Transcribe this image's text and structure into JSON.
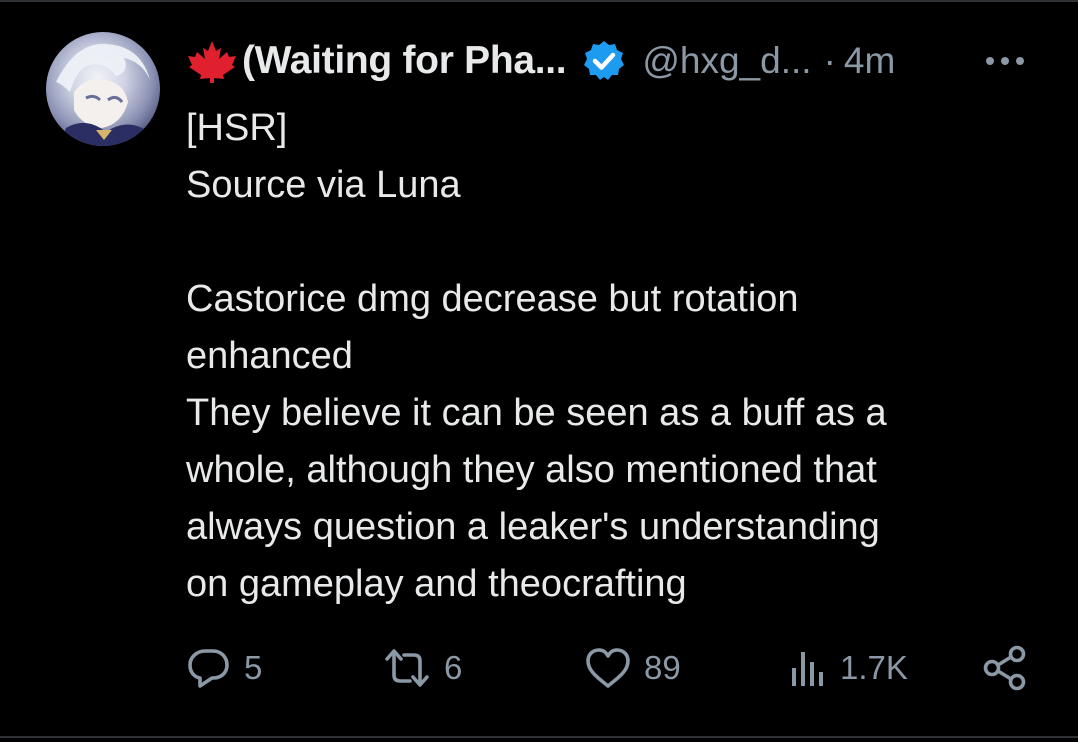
{
  "tweet": {
    "author": {
      "flag_icon": "maple-leaf-icon",
      "display_name": "(Waiting for Pha...",
      "verified_icon": "verified-badge-icon",
      "handle": "@hxg_d...",
      "separator": "·",
      "time": "4m"
    },
    "more_icon": "more-dots-icon",
    "text_lines": [
      "[HSR]",
      "Source via Luna",
      "",
      "Castorice dmg decrease but rotation",
      "enhanced",
      "They believe it can be seen as a buff as a",
      "whole, although they also mentioned that",
      "always question a leaker's understanding",
      "on gameplay and theocrafting"
    ],
    "actions": {
      "reply_count": "5",
      "retweet_count": "6",
      "like_count": "89",
      "views_count": "1.7K"
    }
  },
  "colors": {
    "background": "#000000",
    "primary_text": "#e7e9ea",
    "secondary_text": "#8b98a5",
    "verified_blue": "#1d9bf0",
    "flag_red": "#e0202e",
    "divider": "#2f3336"
  }
}
